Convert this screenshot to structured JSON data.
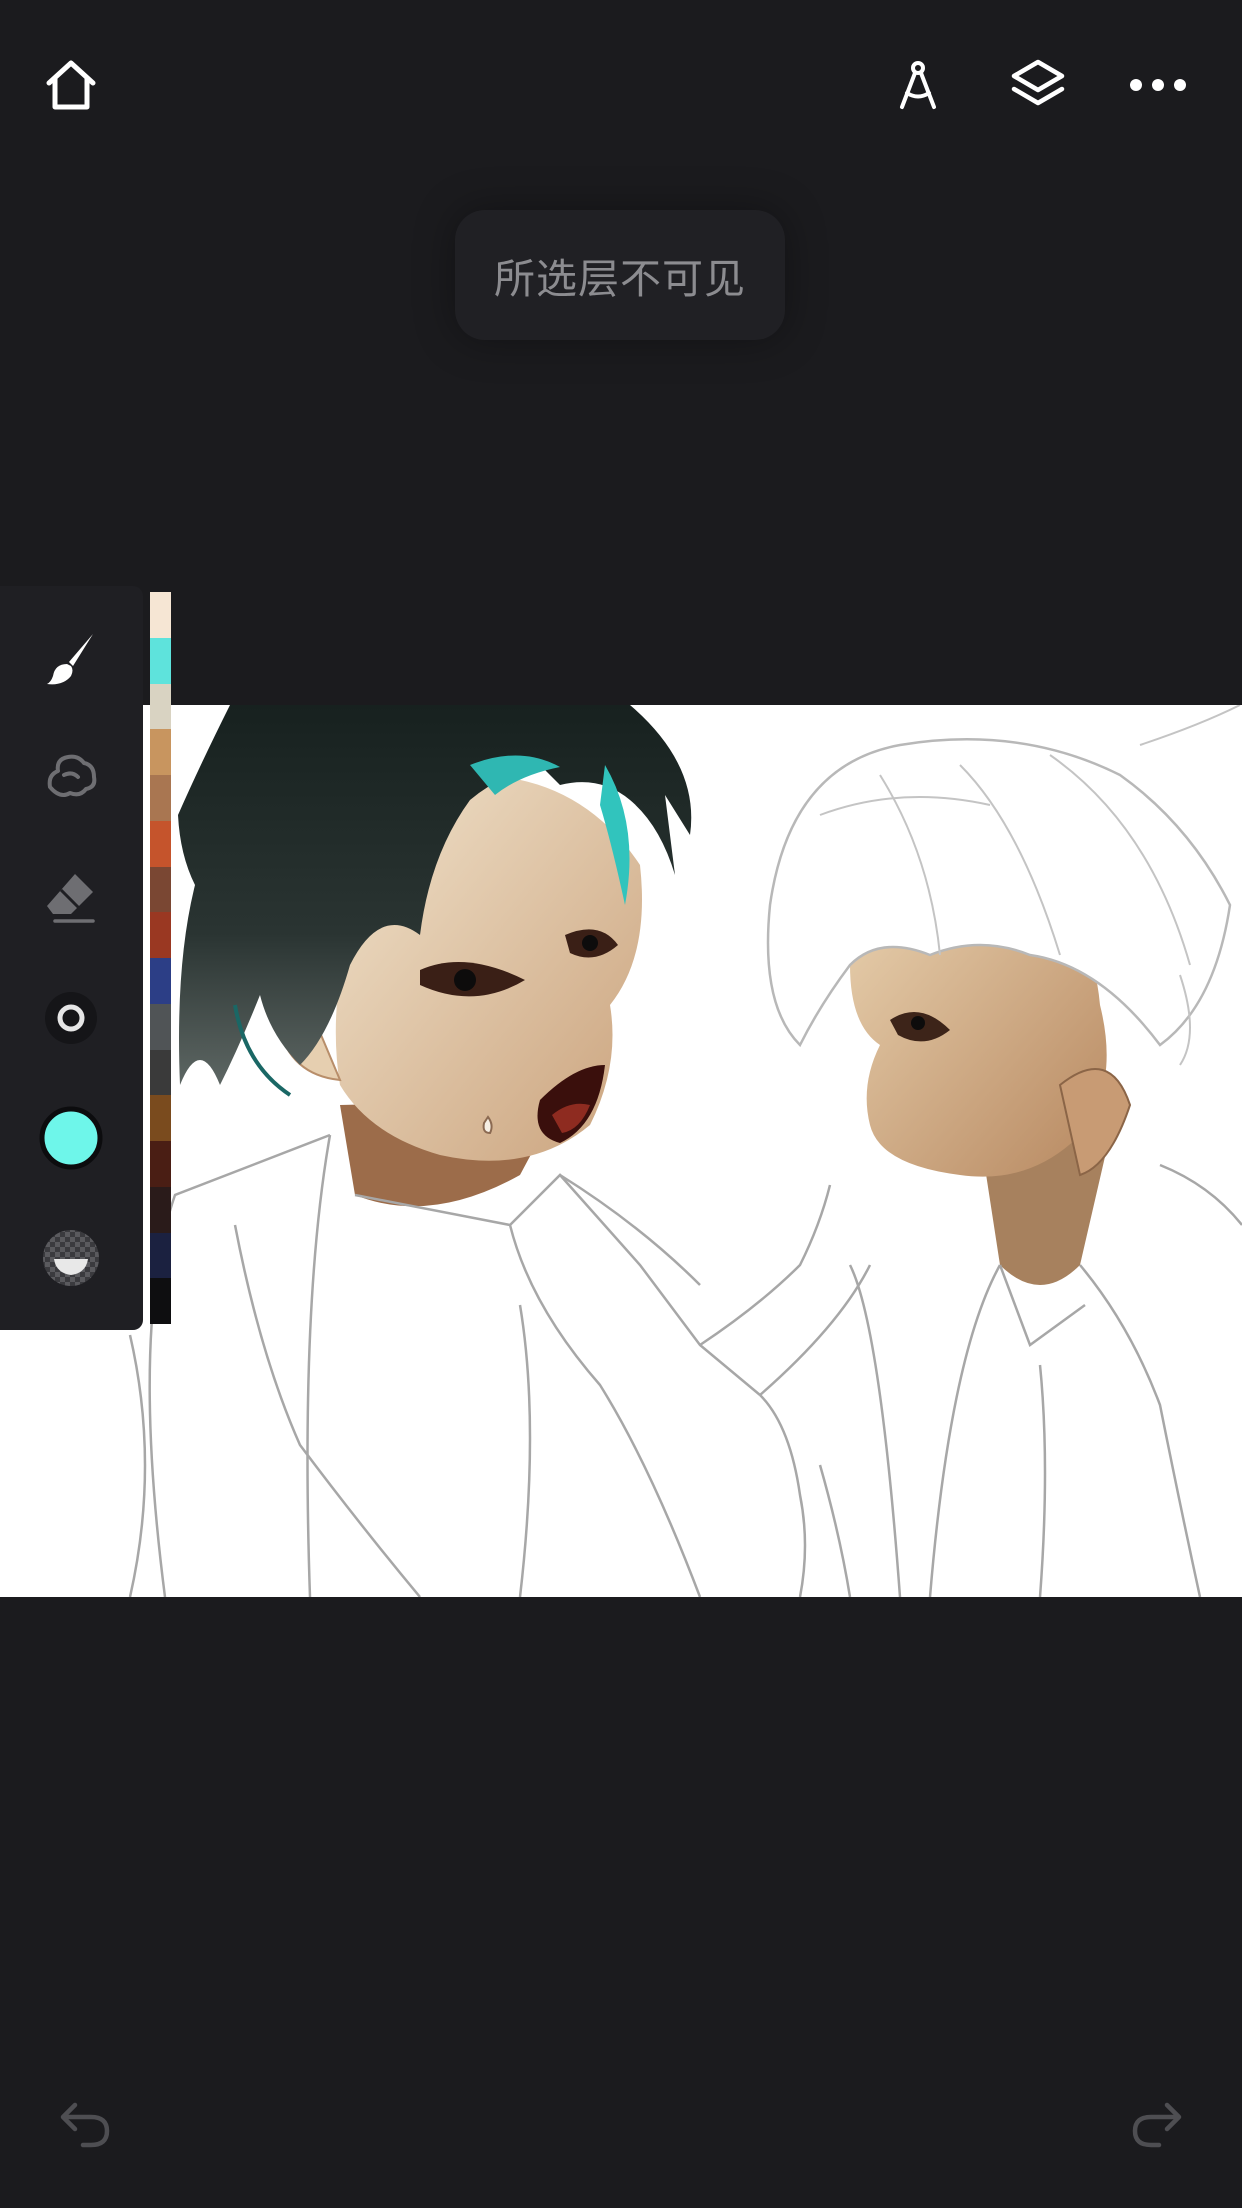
{
  "top_bar": {
    "home_icon": "home-icon",
    "ruler_icon": "compass-ruler-icon",
    "layers_icon": "layers-icon",
    "more_icon": "more-icon"
  },
  "toast": {
    "message": "所选层不可见"
  },
  "toolbar": {
    "tools": [
      {
        "name": "brush-tool",
        "icon": "brush-icon"
      },
      {
        "name": "smudge-tool",
        "icon": "smudge-icon"
      },
      {
        "name": "eraser-tool",
        "icon": "eraser-icon"
      },
      {
        "name": "brush-size",
        "icon": "brush-size-icon"
      },
      {
        "name": "color-picker",
        "icon": "color-circle-icon",
        "color": "#6ef6ea"
      },
      {
        "name": "opacity",
        "icon": "opacity-icon"
      }
    ]
  },
  "palette": {
    "colors": [
      "#f6e6d4",
      "#5ee3dc",
      "#d9d3c2",
      "#c8955f",
      "#a97651",
      "#c5542c",
      "#7a4733",
      "#9a3822",
      "#2c3e86",
      "#505456",
      "#3a3a3a",
      "#7a4b1e",
      "#4a1e14",
      "#2a1b1a",
      "#1b2140",
      "#0e0e10"
    ]
  },
  "bottom_bar": {
    "undo_icon": "undo-icon",
    "redo_icon": "redo-icon"
  },
  "colors": {
    "background": "#1b1b1e",
    "accent": "#6ef6ea",
    "canvas": "#ffffff"
  }
}
